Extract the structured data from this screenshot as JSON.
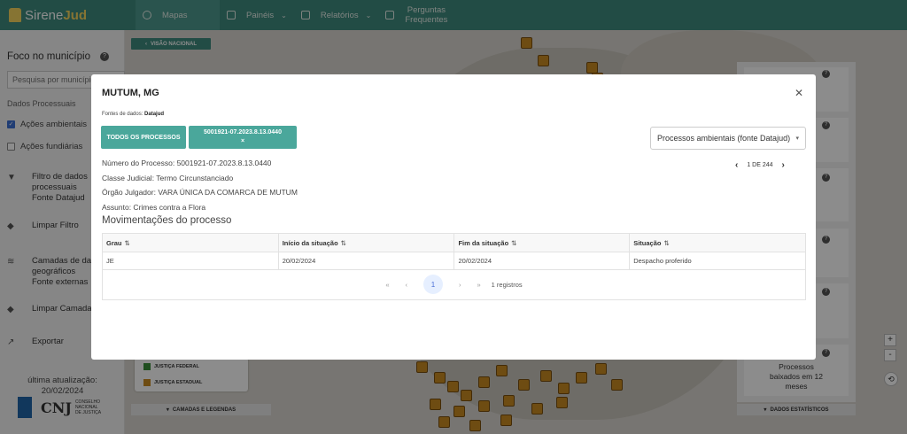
{
  "app": {
    "logo_text_a": "Sirene",
    "logo_text_b": "Jud"
  },
  "nav": {
    "items": [
      {
        "label": "Mapas"
      },
      {
        "label": "Painéis"
      },
      {
        "label": "Relatórios"
      },
      {
        "label_line1": "Perguntas",
        "label_line2": "Frequentes"
      }
    ]
  },
  "sidebar": {
    "title": "Foco no município",
    "search_placeholder": "Pesquisa por município",
    "section_label": "Dados Processuais",
    "checks": [
      {
        "label": "Ações ambientais",
        "checked": true
      },
      {
        "label": "Ações fundiárias",
        "checked": false
      }
    ],
    "actions": [
      {
        "label_lines": [
          "Filtro de dados",
          "processuais",
          "Fonte Datajud"
        ]
      },
      {
        "label_lines": [
          "Limpar Filtro"
        ]
      },
      {
        "label_lines": [
          "Camadas de dados",
          "geográficos",
          "Fonte externas"
        ]
      },
      {
        "label_lines": [
          "Limpar Camadas"
        ]
      },
      {
        "label_lines": [
          "Exportar"
        ]
      }
    ],
    "update_label": "última atualização:",
    "update_date": "20/02/2024",
    "cnj_label": "CNJ",
    "cnj_sub": [
      "CONSELHO",
      "NACIONAL",
      "DE JUSTIÇA"
    ]
  },
  "map": {
    "visao_nacional": "VISÃO NACIONAL",
    "legend_items": [
      "JUSTIÇA FEDERAL",
      "JUSTIÇA ESTADUAL"
    ],
    "legend_button": "CAMADAS E LEGENDAS",
    "stats_button": "DADOS ESTATÍSTICOS",
    "stat_text": [
      "Processos",
      "baixados em 12",
      "meses"
    ],
    "zoom_in": "+",
    "zoom_out": "-",
    "colors": {
      "pin": "#c88a22",
      "federal": "#3a8f3a",
      "estadual": "#c88a22"
    }
  },
  "modal": {
    "title": "MUTUM, MG",
    "source_label": "Fontes de dados:",
    "source_value": "Datajud",
    "btn_all": "TODOS OS PROCESSOS",
    "btn_process": "5001921-07.2023.8.13.0440",
    "btn_process_close": "×",
    "select_value": "Processos ambientais (fonte Datajud)",
    "pager_text": "1 DE 244",
    "fields": [
      "Número do Processo: 5001921-07.2023.8.13.0440",
      "Classe Judicial: Termo Circunstanciado",
      "Órgão Julgador: VARA ÚNICA DA COMARCA DE MUTUM",
      "Assunto: Crimes contra a Flora"
    ],
    "section_title": "Movimentações do processo",
    "table": {
      "headers": [
        "Grau",
        "Início da situação",
        "Fim da situação",
        "Situação"
      ],
      "rows": [
        [
          "JE",
          "20/02/2024",
          "20/02/2024",
          "Despacho proferido"
        ]
      ]
    },
    "pagination": {
      "first": "«",
      "prev": "‹",
      "page": "1",
      "next": "›",
      "last": "»",
      "records": "1 registros"
    },
    "accent": "#4aa79b"
  }
}
